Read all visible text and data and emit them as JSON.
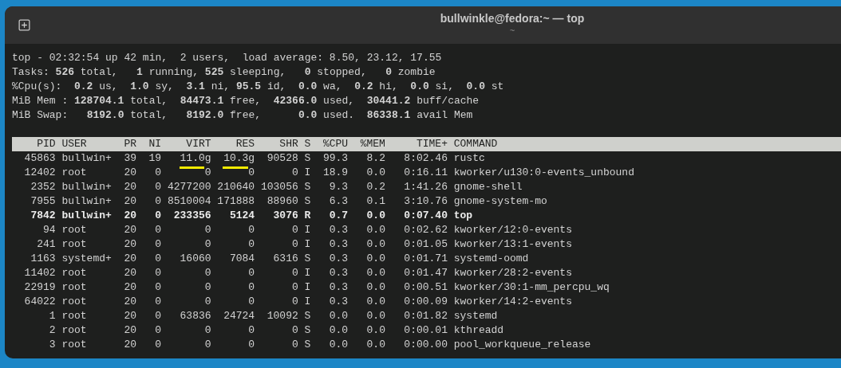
{
  "window": {
    "title": "bullwinkle@fedora:~ — top",
    "subtitle": "~"
  },
  "summary": [
    "top - 02:32:54 up 42 min,  2 users,  load average: 8.50, 23.12, 17.55",
    "Tasks: **526** total,   **1** running, **525** sleeping,   **0** stopped,   **0** zombie",
    "%Cpu(s):  **0.2** us,  **1.0** sy,  **3.1** ni, **95.5** id,  **0.0** wa,  **0.2** hi,  **0.0** si,  **0.0** st",
    "MiB Mem : **128704.1** total,  **84473.1** free,  **42366.0** used,  **30441.2** buff/cache",
    "MiB Swap:   **8192.0** total,   **8192.0** free,      **0.0** used.  **86338.1** avail Mem"
  ],
  "table": {
    "columns": [
      "PID",
      "USER",
      "PR",
      "NI",
      "VIRT",
      "RES",
      "SHR",
      "S",
      "%CPU",
      "%MEM",
      "TIME+",
      "COMMAND"
    ],
    "rows": [
      {
        "cells": [
          "45863",
          "bullwin+",
          "39",
          "19",
          {
            "text": "11.0g",
            "underlined": true
          },
          {
            "text": "10.3g",
            "underlined": true
          },
          "90528",
          "S",
          "99.3",
          "8.2",
          "8:02.46",
          "rustc"
        ],
        "bold": false
      },
      {
        "cells": [
          "12402",
          "root",
          "20",
          "0",
          "0",
          "0",
          "0",
          "I",
          "18.9",
          "0.0",
          "0:16.11",
          "kworker/u130:0-events_unbound"
        ],
        "bold": false
      },
      {
        "cells": [
          "2352",
          "bullwin+",
          "20",
          "0",
          "4277200",
          "210640",
          "103056",
          "S",
          "9.3",
          "0.2",
          "1:41.26",
          "gnome-shell"
        ],
        "bold": false
      },
      {
        "cells": [
          "7955",
          "bullwin+",
          "20",
          "0",
          "8510004",
          "171888",
          "88960",
          "S",
          "6.3",
          "0.1",
          "3:10.76",
          "gnome-system-mo"
        ],
        "bold": false
      },
      {
        "cells": [
          "7842",
          "bullwin+",
          "20",
          "0",
          "233356",
          "5124",
          "3076",
          "R",
          "0.7",
          "0.0",
          "0:07.40",
          "top"
        ],
        "bold": true
      },
      {
        "cells": [
          "94",
          "root",
          "20",
          "0",
          "0",
          "0",
          "0",
          "I",
          "0.3",
          "0.0",
          "0:02.62",
          "kworker/12:0-events"
        ],
        "bold": false
      },
      {
        "cells": [
          "241",
          "root",
          "20",
          "0",
          "0",
          "0",
          "0",
          "I",
          "0.3",
          "0.0",
          "0:01.05",
          "kworker/13:1-events"
        ],
        "bold": false
      },
      {
        "cells": [
          "1163",
          "systemd+",
          "20",
          "0",
          "16060",
          "7084",
          "6316",
          "S",
          "0.3",
          "0.0",
          "0:01.71",
          "systemd-oomd"
        ],
        "bold": false
      },
      {
        "cells": [
          "11402",
          "root",
          "20",
          "0",
          "0",
          "0",
          "0",
          "I",
          "0.3",
          "0.0",
          "0:01.47",
          "kworker/28:2-events"
        ],
        "bold": false
      },
      {
        "cells": [
          "22919",
          "root",
          "20",
          "0",
          "0",
          "0",
          "0",
          "I",
          "0.3",
          "0.0",
          "0:00.51",
          "kworker/30:1-mm_percpu_wq"
        ],
        "bold": false
      },
      {
        "cells": [
          "64022",
          "root",
          "20",
          "0",
          "0",
          "0",
          "0",
          "I",
          "0.3",
          "0.0",
          "0:00.09",
          "kworker/14:2-events"
        ],
        "bold": false
      },
      {
        "cells": [
          "1",
          "root",
          "20",
          "0",
          "63836",
          "24724",
          "10092",
          "S",
          "0.0",
          "0.0",
          "0:01.82",
          "systemd"
        ],
        "bold": false
      },
      {
        "cells": [
          "2",
          "root",
          "20",
          "0",
          "0",
          "0",
          "0",
          "S",
          "0.0",
          "0.0",
          "0:00.01",
          "kthreadd"
        ],
        "bold": false
      },
      {
        "cells": [
          "3",
          "root",
          "20",
          "0",
          "0",
          "0",
          "0",
          "S",
          "0.0",
          "0.0",
          "0:00.00",
          "pool_workqueue_release"
        ],
        "bold": false
      }
    ]
  }
}
